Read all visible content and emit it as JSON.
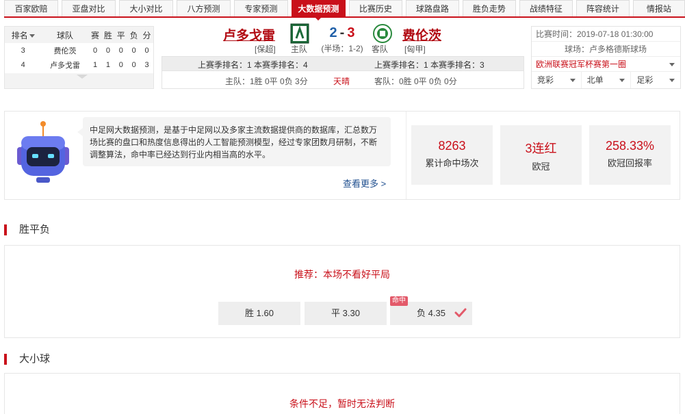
{
  "tabs": [
    {
      "label": "百家欧赔",
      "active": false
    },
    {
      "label": "亚盘对比",
      "active": false
    },
    {
      "label": "大小对比",
      "active": false
    },
    {
      "label": "八方预测",
      "active": false
    },
    {
      "label": "专家预测",
      "active": false
    },
    {
      "label": "大数据预测",
      "active": true
    },
    {
      "label": "比赛历史",
      "active": false
    },
    {
      "label": "球路盘路",
      "active": false
    },
    {
      "label": "胜负走势",
      "active": false
    },
    {
      "label": "战绩特征",
      "active": false
    },
    {
      "label": "阵容统计",
      "active": false
    },
    {
      "label": "情报站",
      "active": false
    }
  ],
  "standings": {
    "headers": [
      "排名",
      "球队",
      "赛",
      "胜",
      "平",
      "负",
      "分"
    ],
    "rows": [
      {
        "rank": "3",
        "team": "费伦茨",
        "played": "0",
        "won": "0",
        "draw": "0",
        "lost": "0",
        "pts": "0"
      },
      {
        "rank": "4",
        "team": "卢多戈雷",
        "played": "1",
        "won": "1",
        "draw": "0",
        "lost": "0",
        "pts": "3"
      }
    ]
  },
  "match": {
    "home": {
      "name": "卢多戈雷",
      "league": "[保超]",
      "label": "主队"
    },
    "away": {
      "name": "费伦茨",
      "league": "[匈甲]",
      "label": "客队"
    },
    "score": {
      "home": "2",
      "sep": "-",
      "away": "3"
    },
    "half": "(半场：1-2)",
    "home_rank": "上赛季排名：1 本赛季排名：4",
    "away_rank": "上赛季排名：1 本赛季排名：3",
    "home_record": "主队：1胜 0平 0负 3分",
    "weather": "天晴",
    "away_record": "客队：0胜 0平 0负 0分"
  },
  "info": {
    "time": "比赛时间：2019-07-18 01:30:00",
    "venue": "球场：卢多格德斯球场",
    "competition": "欧洲联赛冠军杯赛第一圈",
    "selects": [
      "竞彩",
      "北单",
      "足彩"
    ]
  },
  "intro": {
    "text": "中足网大数据预测，是基于中足网以及多家主流数据提供商的数据库，汇总数万场比赛的盘口和热度信息得出的人工智能预测模型，经过专家团数月研制，不断调整算法，命中率已经达到行业内相当高的水平。",
    "more": "查看更多 >",
    "stats": [
      {
        "value": "8263",
        "label": "累计命中场次"
      },
      {
        "value": "3连红",
        "label": "欧冠"
      },
      {
        "value": "258.33%",
        "label": "欧冠回报率"
      }
    ]
  },
  "wdl": {
    "title": "胜平负",
    "recommend": "推荐：本场不看好平局",
    "odds": [
      {
        "label": "胜 1.60",
        "hit": false
      },
      {
        "label": "平 3.30",
        "hit": false
      },
      {
        "label": "负 4.35",
        "hit": true
      }
    ],
    "hit_tag": "命中"
  },
  "ou": {
    "title": "大小球",
    "message": "条件不足，暂时无法判断"
  },
  "colors": {
    "accent": "#c9101a",
    "home_score": "#1f5fa8",
    "link": "#1f4f8f"
  }
}
